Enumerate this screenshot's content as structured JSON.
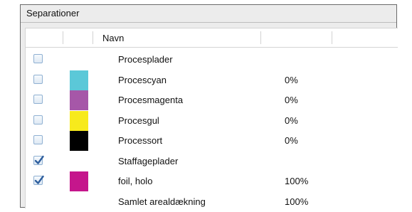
{
  "panel": {
    "title": "Separationer",
    "column_name_header": "Navn"
  },
  "rows": [
    {
      "label": "Procesplader",
      "checked": false,
      "swatch": null,
      "coverage": ""
    },
    {
      "label": "Procescyan",
      "checked": false,
      "swatch": "#5bc8d8",
      "coverage": "0%"
    },
    {
      "label": "Procesmagenta",
      "checked": false,
      "swatch": "#a657a8",
      "coverage": "0%"
    },
    {
      "label": "Procesgul",
      "checked": false,
      "swatch": "#f7ea1c",
      "coverage": "0%"
    },
    {
      "label": "Processort",
      "checked": false,
      "swatch": "#000000",
      "coverage": "0%"
    },
    {
      "label": "Staffageplader",
      "checked": true,
      "swatch": null,
      "coverage": ""
    },
    {
      "label": "foil, holo",
      "checked": true,
      "swatch": "#c5168c",
      "coverage": "100%"
    },
    {
      "label": "Samlet arealdækning",
      "checked": false,
      "swatch": null,
      "coverage": "100%",
      "no_checkbox": true
    }
  ]
}
